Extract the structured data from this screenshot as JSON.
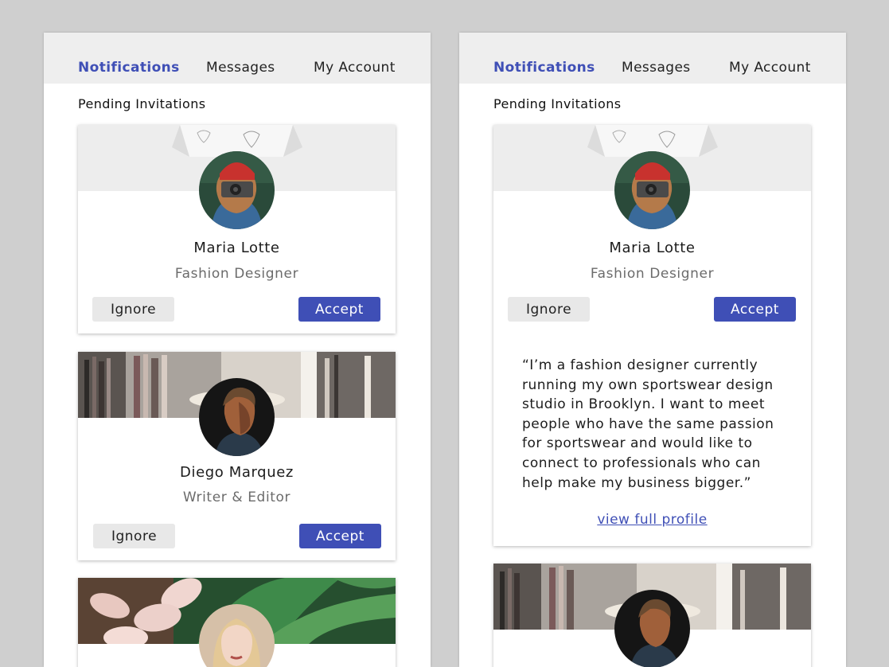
{
  "nav": {
    "tabs": [
      {
        "label": "Notifications"
      },
      {
        "label": "Messages"
      },
      {
        "label": "My Account"
      }
    ],
    "active_color": "#3f4fb6"
  },
  "section_title": "Pending Invitations",
  "invitations": [
    {
      "name": "Maria Lotte",
      "role": "Fashion Designer",
      "ignore_label": "Ignore",
      "accept_label": "Accept"
    },
    {
      "name": "Diego Marquez",
      "role": "Writer & Editor",
      "ignore_label": "Ignore",
      "accept_label": "Accept"
    }
  ],
  "expanded": {
    "bio": "“I’m a fashion designer currently running my own sportswear design studio in Brooklyn. I want to meet people who have the same passion for sportswear and would like to connect to professionals who can help make my business bigger.”",
    "link_label": "view full profile"
  },
  "colors": {
    "accent": "#3f4fb6",
    "ignore_bg": "#e8e8e8",
    "nav_bg": "#eeeeee",
    "page_bg": "#cfcfcf"
  }
}
